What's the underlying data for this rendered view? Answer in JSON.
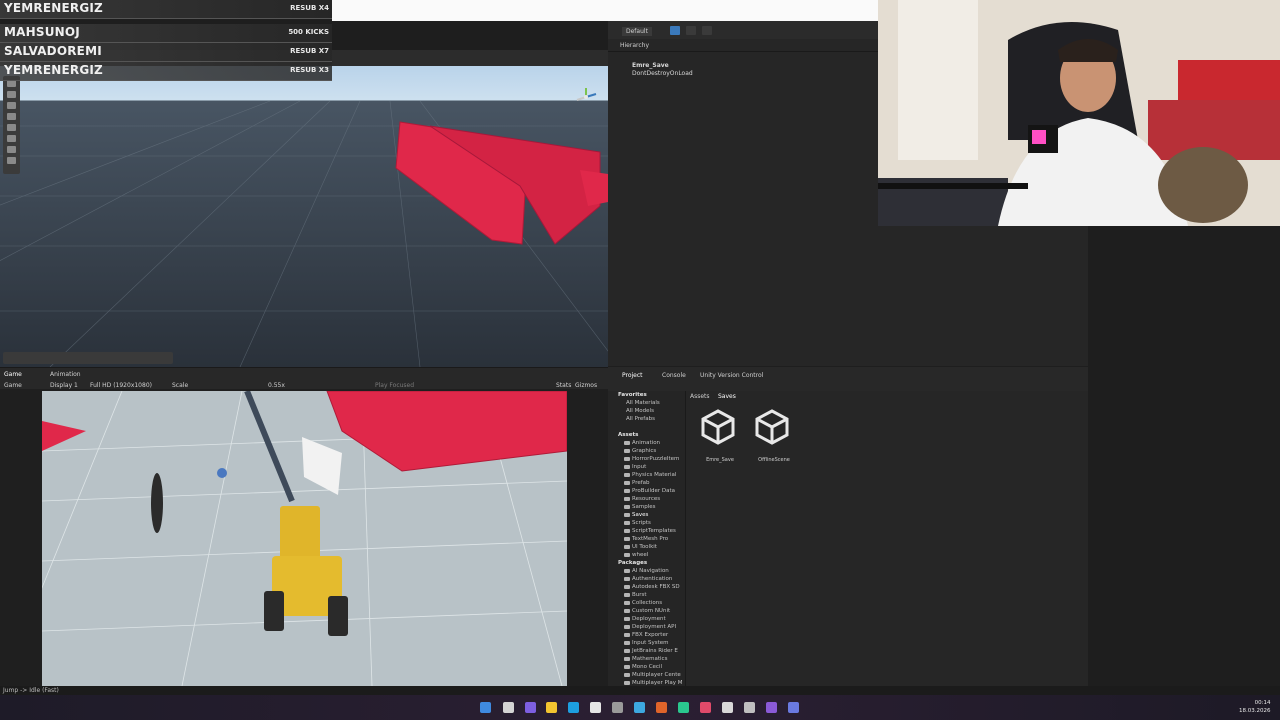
{
  "alerts": [
    {
      "name": "YEMRENERGIZ",
      "tag": "RESUB X4"
    },
    {
      "name": "MAHSUNOJ",
      "tag": "500 KICKS"
    },
    {
      "name": "SALVADOREMI",
      "tag": "RESUB X7"
    },
    {
      "name": "YEMRENERGIZ",
      "tag": "RESUB X3"
    }
  ],
  "toolbar": {
    "default_label": "Default"
  },
  "hierarchy": {
    "tab": "Hierarchy",
    "items": [
      "Emre_Save",
      "DontDestroyOnLoad"
    ]
  },
  "game": {
    "tab_game": "Game",
    "tab_animation": "Animation",
    "display": "Display 1",
    "resolution": "Full HD (1920x1080)",
    "scale_label": "Scale",
    "scale_value": "0.55x",
    "play_focused": "Play Focused",
    "stats": "Stats",
    "gizmos": "Gizmos"
  },
  "project": {
    "tab_project": "Project",
    "tab_console": "Console",
    "tab_vc": "Unity Version Control",
    "breadcrumb": [
      "Assets",
      "Saves"
    ],
    "favorites_label": "Favorites",
    "favorites": [
      "All Materials",
      "All Models",
      "All Prefabs"
    ],
    "assets_label": "Assets",
    "assets": [
      "Animation",
      "Graphics",
      "HorrorPuzzleItem",
      "Input",
      "Physics Material",
      "Prefab",
      "ProBuilder Data",
      "Resources",
      "Samples",
      "Saves",
      "Scripts",
      "ScriptTemplates",
      "TextMesh Pro",
      "UI Toolkit",
      "wheel"
    ],
    "packages_label": "Packages",
    "packages": [
      "AI Navigation",
      "Authentication",
      "Autodesk FBX SD",
      "Burst",
      "Collections",
      "Custom NUnit",
      "Deployment",
      "Deployment API",
      "FBX Exporter",
      "Input System",
      "JetBrains Rider E",
      "Mathematics",
      "Mono Cecil",
      "Multiplayer Cente",
      "Multiplayer Play M"
    ],
    "files": [
      "Emre_Save",
      "OfflineScene"
    ]
  },
  "status": {
    "text": "Jump -> Idle (Fast)"
  },
  "clock": {
    "time": "00:14",
    "date": "18.03.2026"
  },
  "colors": {
    "accent_red": "#e0284a",
    "unity_blue": "#3a79bb",
    "excavator_yellow": "#e0b52a"
  }
}
